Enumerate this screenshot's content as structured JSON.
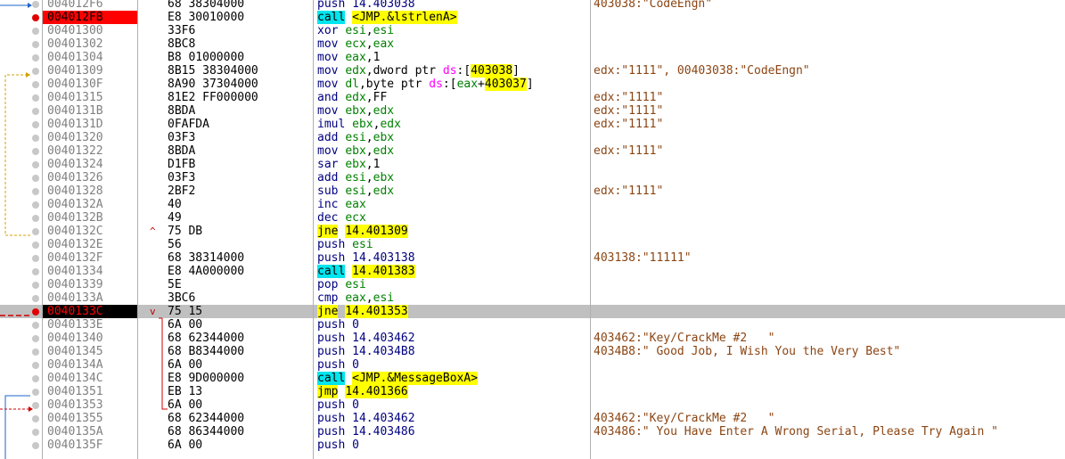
{
  "rows": [
    {
      "addr": "004012F6",
      "bytes": "68 38304000",
      "dis": [
        [
          "push",
          "mn"
        ],
        [
          " 14.403038",
          "imm"
        ]
      ],
      "cmt": "403038:\"CodeEngn\"",
      "dot": "grey"
    },
    {
      "addr": "004012FB",
      "bytes": "E8 30010000",
      "dis": [
        [
          "call",
          "call"
        ],
        [
          " ",
          ""
        ],
        [
          "<JMP.&lstrlenA>",
          "hl"
        ]
      ],
      "cmt": "",
      "dot": "red",
      "bp": true
    },
    {
      "addr": "00401300",
      "bytes": "33F6",
      "dis": [
        [
          "xor",
          "mn"
        ],
        [
          " ",
          ""
        ],
        [
          "esi",
          "reg"
        ],
        [
          ",",
          ""
        ],
        [
          "esi",
          "reg"
        ]
      ],
      "cmt": "",
      "dot": "grey"
    },
    {
      "addr": "00401302",
      "bytes": "8BC8",
      "dis": [
        [
          "mov",
          "mn"
        ],
        [
          " ",
          ""
        ],
        [
          "ecx",
          "reg"
        ],
        [
          ",",
          ""
        ],
        [
          "eax",
          "reg"
        ]
      ],
      "cmt": "",
      "dot": "grey"
    },
    {
      "addr": "00401304",
      "bytes": "B8 01000000",
      "dis": [
        [
          "mov",
          "mn"
        ],
        [
          " ",
          ""
        ],
        [
          "eax",
          "reg"
        ],
        [
          ",1",
          ""
        ]
      ],
      "cmt": "",
      "dot": "grey"
    },
    {
      "addr": "00401309",
      "bytes": "8B15 38304000",
      "dis": [
        [
          "mov",
          "mn"
        ],
        [
          " ",
          ""
        ],
        [
          "edx",
          "reg"
        ],
        [
          ",dword ptr ",
          ""
        ],
        [
          "ds",
          "seg"
        ],
        [
          ":[",
          ""
        ],
        [
          "403038",
          "hl"
        ],
        [
          "]",
          ""
        ]
      ],
      "cmt": "edx:\"1111\", 00403038:\"CodeEngn\"",
      "dot": "grey"
    },
    {
      "addr": "0040130F",
      "bytes": "8A90 37304000",
      "dis": [
        [
          "mov",
          "mn"
        ],
        [
          " ",
          ""
        ],
        [
          "dl",
          "reg"
        ],
        [
          ",byte ptr ",
          ""
        ],
        [
          "ds",
          "seg"
        ],
        [
          ":[",
          ""
        ],
        [
          "eax",
          "reg"
        ],
        [
          "+",
          ""
        ],
        [
          "403037",
          "hl"
        ],
        [
          "]",
          ""
        ]
      ],
      "cmt": "",
      "dot": "grey"
    },
    {
      "addr": "00401315",
      "bytes": "81E2 FF000000",
      "dis": [
        [
          "and",
          "mn"
        ],
        [
          " ",
          ""
        ],
        [
          "edx",
          "reg"
        ],
        [
          ",FF",
          ""
        ]
      ],
      "cmt": "edx:\"1111\"",
      "dot": "grey"
    },
    {
      "addr": "0040131B",
      "bytes": "8BDA",
      "dis": [
        [
          "mov",
          "mn"
        ],
        [
          " ",
          ""
        ],
        [
          "ebx",
          "reg"
        ],
        [
          ",",
          ""
        ],
        [
          "edx",
          "reg"
        ]
      ],
      "cmt": "edx:\"1111\"",
      "dot": "grey"
    },
    {
      "addr": "0040131D",
      "bytes": "0FAFDA",
      "dis": [
        [
          "imul",
          "mn"
        ],
        [
          " ",
          ""
        ],
        [
          "ebx",
          "reg"
        ],
        [
          ",",
          ""
        ],
        [
          "edx",
          "reg"
        ]
      ],
      "cmt": "edx:\"1111\"",
      "dot": "grey"
    },
    {
      "addr": "00401320",
      "bytes": "03F3",
      "dis": [
        [
          "add",
          "mn"
        ],
        [
          " ",
          ""
        ],
        [
          "esi",
          "reg"
        ],
        [
          ",",
          ""
        ],
        [
          "ebx",
          "reg"
        ]
      ],
      "cmt": "",
      "dot": "grey"
    },
    {
      "addr": "00401322",
      "bytes": "8BDA",
      "dis": [
        [
          "mov",
          "mn"
        ],
        [
          " ",
          ""
        ],
        [
          "ebx",
          "reg"
        ],
        [
          ",",
          ""
        ],
        [
          "edx",
          "reg"
        ]
      ],
      "cmt": "edx:\"1111\"",
      "dot": "grey"
    },
    {
      "addr": "00401324",
      "bytes": "D1FB",
      "dis": [
        [
          "sar",
          "mn"
        ],
        [
          " ",
          ""
        ],
        [
          "ebx",
          "reg"
        ],
        [
          ",1",
          ""
        ]
      ],
      "cmt": "",
      "dot": "grey"
    },
    {
      "addr": "00401326",
      "bytes": "03F3",
      "dis": [
        [
          "add",
          "mn"
        ],
        [
          " ",
          ""
        ],
        [
          "esi",
          "reg"
        ],
        [
          ",",
          ""
        ],
        [
          "ebx",
          "reg"
        ]
      ],
      "cmt": "",
      "dot": "grey"
    },
    {
      "addr": "00401328",
      "bytes": "2BF2",
      "dis": [
        [
          "sub",
          "mn"
        ],
        [
          " ",
          ""
        ],
        [
          "esi",
          "reg"
        ],
        [
          ",",
          ""
        ],
        [
          "edx",
          "reg"
        ]
      ],
      "cmt": "edx:\"1111\"",
      "dot": "grey"
    },
    {
      "addr": "0040132A",
      "bytes": "40",
      "dis": [
        [
          "inc",
          "mn"
        ],
        [
          " ",
          ""
        ],
        [
          "eax",
          "reg"
        ]
      ],
      "cmt": "",
      "dot": "grey"
    },
    {
      "addr": "0040132B",
      "bytes": "49",
      "dis": [
        [
          "dec",
          "mn"
        ],
        [
          " ",
          ""
        ],
        [
          "ecx",
          "reg"
        ]
      ],
      "cmt": "",
      "dot": "grey"
    },
    {
      "addr": "0040132C",
      "bytes": "75 DB",
      "arrow": "^",
      "dis": [
        [
          "jne",
          "jmp"
        ],
        [
          " ",
          ""
        ],
        [
          "14.401309",
          "hl"
        ]
      ],
      "cmt": "",
      "dot": "grey"
    },
    {
      "addr": "0040132E",
      "bytes": "56",
      "dis": [
        [
          "push",
          "mn"
        ],
        [
          " ",
          ""
        ],
        [
          "esi",
          "reg"
        ]
      ],
      "cmt": "",
      "dot": "grey"
    },
    {
      "addr": "0040132F",
      "bytes": "68 38314000",
      "dis": [
        [
          "push",
          "mn"
        ],
        [
          " 14.403138",
          "imm"
        ]
      ],
      "cmt": "403138:\"11111\"",
      "dot": "grey"
    },
    {
      "addr": "00401334",
      "bytes": "E8 4A000000",
      "dis": [
        [
          "call",
          "call"
        ],
        [
          " ",
          ""
        ],
        [
          "14.401383",
          "hl"
        ]
      ],
      "cmt": "",
      "dot": "grey"
    },
    {
      "addr": "00401339",
      "bytes": "5E",
      "dis": [
        [
          "pop",
          "mn"
        ],
        [
          " ",
          ""
        ],
        [
          "esi",
          "reg"
        ]
      ],
      "cmt": "",
      "dot": "grey"
    },
    {
      "addr": "0040133A",
      "bytes": "3BC6",
      "dis": [
        [
          "cmp",
          "mn"
        ],
        [
          " ",
          ""
        ],
        [
          "eax",
          "reg"
        ],
        [
          ",",
          ""
        ],
        [
          "esi",
          "reg"
        ]
      ],
      "cmt": "",
      "dot": "grey"
    },
    {
      "addr": "0040133C",
      "bytes": "75 15",
      "arrow": "v",
      "dis": [
        [
          "jne",
          "jmp"
        ],
        [
          " ",
          ""
        ],
        [
          "14.401353",
          "hl"
        ]
      ],
      "cmt": "",
      "dot": "red",
      "bp": true,
      "hl": true
    },
    {
      "addr": "0040133E",
      "bytes": "6A 00",
      "dis": [
        [
          "push",
          "mn"
        ],
        [
          " 0",
          "imm"
        ]
      ],
      "cmt": "",
      "dot": "grey"
    },
    {
      "addr": "00401340",
      "bytes": "68 62344000",
      "dis": [
        [
          "push",
          "mn"
        ],
        [
          " 14.403462",
          "imm"
        ]
      ],
      "cmt": "403462:\"Key/CrackMe #2   \"",
      "dot": "grey"
    },
    {
      "addr": "00401345",
      "bytes": "68 B8344000",
      "dis": [
        [
          "push",
          "mn"
        ],
        [
          " 14.4034B8",
          "imm"
        ]
      ],
      "cmt": "4034B8:\" Good Job, I Wish You the Very Best\"",
      "dot": "grey"
    },
    {
      "addr": "0040134A",
      "bytes": "6A 00",
      "dis": [
        [
          "push",
          "mn"
        ],
        [
          " 0",
          "imm"
        ]
      ],
      "cmt": "",
      "dot": "grey"
    },
    {
      "addr": "0040134C",
      "bytes": "E8 9D000000",
      "dis": [
        [
          "call",
          "call"
        ],
        [
          " ",
          ""
        ],
        [
          "<JMP.&MessageBoxA>",
          "hl"
        ]
      ],
      "cmt": "",
      "dot": "grey"
    },
    {
      "addr": "00401351",
      "bytes": "EB 13",
      "dis": [
        [
          "jmp",
          "jmp"
        ],
        [
          " ",
          ""
        ],
        [
          "14.401366",
          "hl"
        ]
      ],
      "cmt": "",
      "dot": "grey"
    },
    {
      "addr": "00401353",
      "bytes": "6A 00",
      "dis": [
        [
          "push",
          "mn"
        ],
        [
          " 0",
          "imm"
        ]
      ],
      "cmt": "",
      "dot": "grey"
    },
    {
      "addr": "00401355",
      "bytes": "68 62344000",
      "dis": [
        [
          "push",
          "mn"
        ],
        [
          " 14.403462",
          "imm"
        ]
      ],
      "cmt": "403462:\"Key/CrackMe #2   \"",
      "dot": "grey"
    },
    {
      "addr": "0040135A",
      "bytes": "68 86344000",
      "dis": [
        [
          "push",
          "mn"
        ],
        [
          " 14.403486",
          "imm"
        ]
      ],
      "cmt": "403486:\" You Have Enter A Wrong Serial, Please Try Again \"",
      "dot": "grey"
    },
    {
      "addr": "0040135F",
      "bytes": "6A 00",
      "dis": [
        [
          "push",
          "mn"
        ],
        [
          " 0",
          "imm"
        ]
      ],
      "cmt": "",
      "dot": "grey"
    }
  ],
  "colors": {
    "breakpoint": "#ff0000",
    "current": "#c0c0c0",
    "call_bg": "#00e5ee",
    "target_bg": "#ffff00",
    "register": "#008000",
    "comment": "#8b4513",
    "segment": "#ff00ff"
  }
}
